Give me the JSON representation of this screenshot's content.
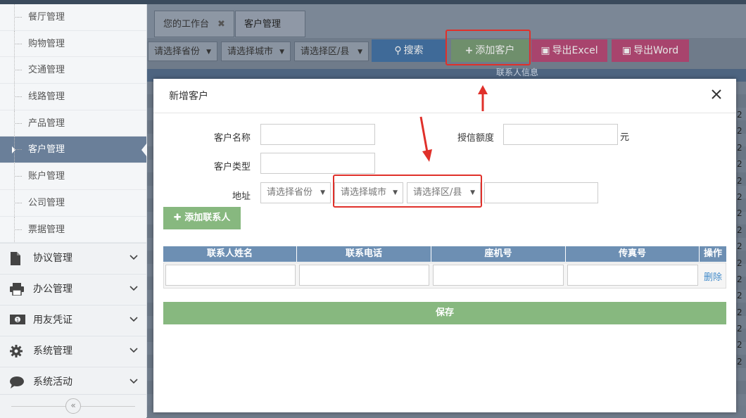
{
  "sidebar": {
    "sub_items": [
      {
        "label": "餐厅管理"
      },
      {
        "label": "购物管理"
      },
      {
        "label": "交通管理"
      },
      {
        "label": "线路管理"
      },
      {
        "label": "产品管理"
      },
      {
        "label": "客户管理",
        "active": true
      },
      {
        "label": "账户管理"
      },
      {
        "label": "公司管理"
      },
      {
        "label": "票据管理"
      }
    ],
    "groups": [
      {
        "label": "协议管理",
        "icon": "document-icon"
      },
      {
        "label": "办公管理",
        "icon": "printer-icon"
      },
      {
        "label": "用友凭证",
        "icon": "money-icon"
      },
      {
        "label": "系统管理",
        "icon": "gear-icon"
      },
      {
        "label": "系统活动",
        "icon": "comment-icon"
      }
    ],
    "collapse_glyph": "«"
  },
  "tabs": [
    {
      "label": "您的工作台",
      "close": "✖"
    },
    {
      "label": "客户管理",
      "close": "✖"
    }
  ],
  "toolbar": {
    "province_placeholder": "请选择省份",
    "city_placeholder": "请选择城市",
    "district_placeholder": "请选择区/县",
    "search_label": "搜索",
    "add_customer_label": "添加客户",
    "export_excel_label": "导出Excel",
    "export_word_label": "导出Word",
    "search_color": "#4c7fb8",
    "add_color": "#87b87f",
    "export_color": "#d6487e"
  },
  "background_table": {
    "header_fragment": "联系人信息",
    "right_column_digit": "2"
  },
  "dialog": {
    "title": "新增客户",
    "fields": {
      "customer_name_label": "客户名称",
      "credit_label": "授信额度",
      "credit_unit": "元",
      "customer_type_label": "客户类型",
      "address_label": "地址",
      "province_placeholder": "请选择省份",
      "city_placeholder": "请选择城市",
      "district_placeholder": "请选择区/县"
    },
    "add_contact_label": "添加联系人",
    "contact_table": {
      "headers": [
        "联系人姓名",
        "联系电话",
        "座机号",
        "传真号",
        "操作"
      ],
      "delete_label": "删除"
    },
    "save_label": "保存"
  },
  "colors": {
    "annotation_red": "#e0302a",
    "sidebar_active": "#6a7f99",
    "table_header": "#6d8fb3"
  }
}
